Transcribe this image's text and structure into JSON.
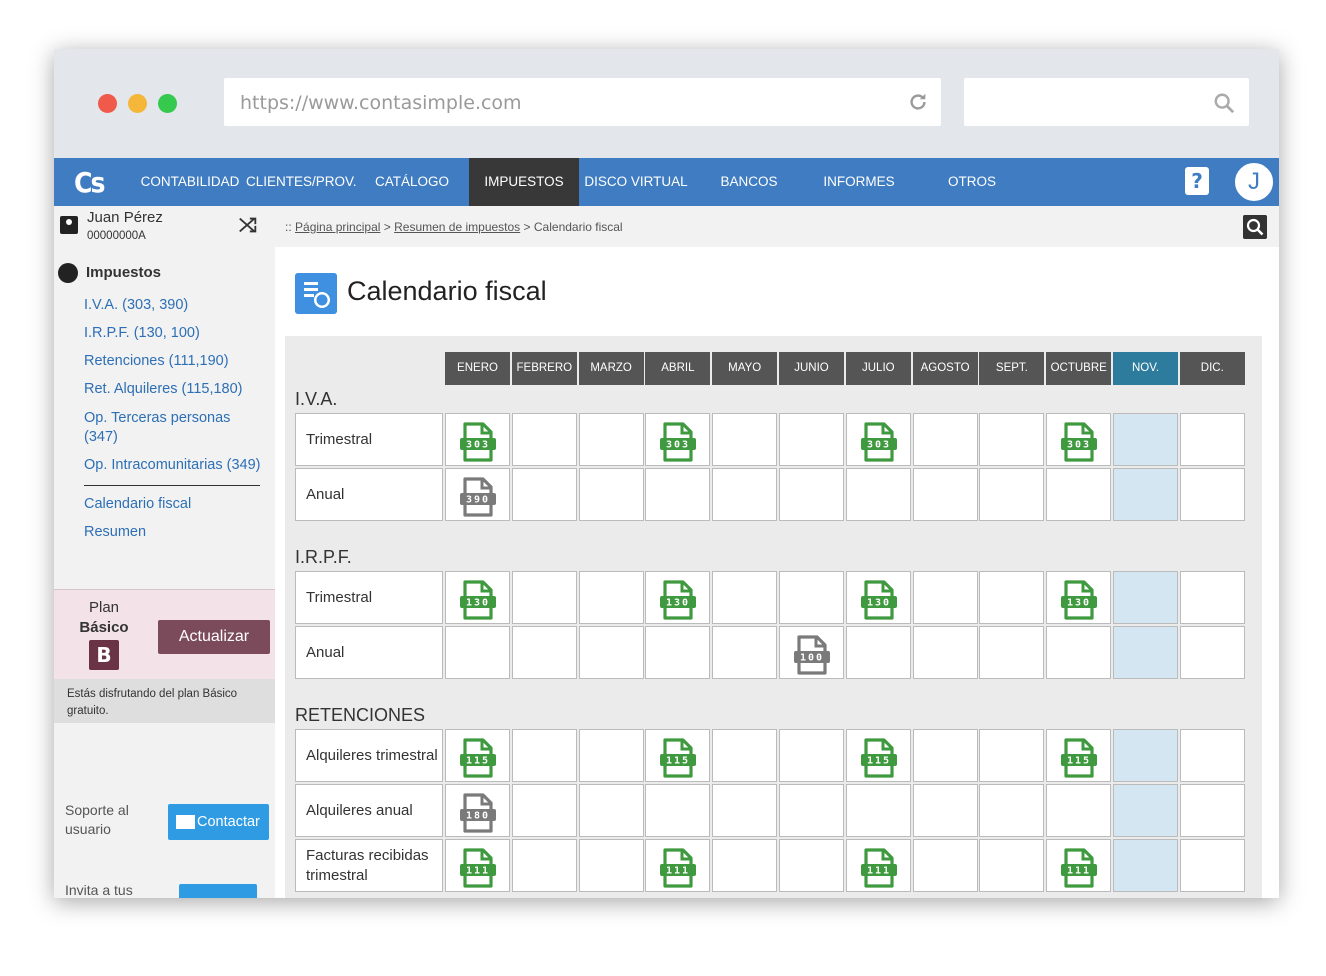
{
  "browser": {
    "url": "https://www.contasimple.com"
  },
  "nav": {
    "logo": "Cs",
    "items": [
      "CONTABILIDAD",
      "CLIENTES/PROV.",
      "CATÁLOGO",
      "IMPUESTOS",
      "DISCO VIRTUAL",
      "BANCOS",
      "INFORMES",
      "OTROS"
    ],
    "active": "IMPUESTOS",
    "help": "?",
    "avatar": "J"
  },
  "user": {
    "name": "Juan Pérez",
    "id": "00000000A"
  },
  "sidebar": {
    "section_title": "Impuestos",
    "links": [
      "I.V.A. (303, 390)",
      "I.R.P.F. (130, 100)",
      "Retenciones (111,190)",
      "Ret. Alquileres (115,180)",
      "Op. Terceras personas (347)",
      "Op. Intracomunitarias (349)"
    ],
    "links2": [
      "Calendario fiscal",
      "Resumen"
    ],
    "plan": {
      "line1": "Plan",
      "line2": "Básico",
      "badge": "B",
      "button": "Actualizar",
      "note": "Estás disfrutando del plan Básico gratuito."
    },
    "support": {
      "label": "Soporte al usuario",
      "button": "Contactar"
    },
    "invite": {
      "label": "Invita a tus"
    }
  },
  "breadcrumb": {
    "prefix": "::",
    "items": [
      "Página principal",
      "Resumen de impuestos"
    ],
    "current": "Calendario fiscal",
    "sep": ">"
  },
  "page": {
    "title": "Calendario fiscal"
  },
  "calendar": {
    "months": [
      "ENERO",
      "FEBRERO",
      "MARZO",
      "ABRIL",
      "MAYO",
      "JUNIO",
      "JULIO",
      "AGOSTO",
      "SEPT.",
      "OCTUBRE",
      "NOV.",
      "DIC."
    ],
    "current_month_index": 10,
    "groups": [
      {
        "title": "I.V.A.",
        "rows": [
          {
            "label": "Trimestral",
            "forms": {
              "0": "303",
              "3": "303",
              "6": "303",
              "9": "303"
            },
            "color": "green"
          },
          {
            "label": "Anual",
            "forms": {
              "0": "390"
            },
            "color": "gray"
          }
        ]
      },
      {
        "title": "I.R.P.F.",
        "rows": [
          {
            "label": "Trimestral",
            "forms": {
              "0": "130",
              "3": "130",
              "6": "130",
              "9": "130"
            },
            "color": "green"
          },
          {
            "label": "Anual",
            "forms": {
              "5": "100"
            },
            "color": "gray"
          }
        ]
      },
      {
        "title": "RETENCIONES",
        "rows": [
          {
            "label": "Alquileres trimestral",
            "forms": {
              "0": "115",
              "3": "115",
              "6": "115",
              "9": "115"
            },
            "color": "green"
          },
          {
            "label": "Alquileres anual",
            "forms": {
              "0": "180"
            },
            "color": "gray"
          },
          {
            "label": "Facturas recibidas trimestral",
            "forms": {
              "0": "111",
              "3": "111",
              "6": "111",
              "9": "111"
            },
            "color": "green"
          }
        ]
      }
    ],
    "colors": {
      "green": "#3f9a3f",
      "gray": "#7a7a7a",
      "current": "#d3e6f2",
      "current_header": "#2d7c9e"
    }
  }
}
